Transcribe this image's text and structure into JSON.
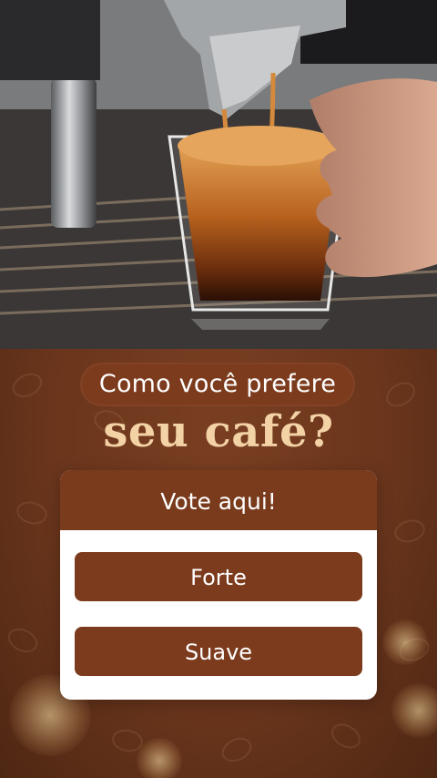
{
  "poll": {
    "question": "Como você prefere",
    "headline": "seu café?",
    "card_title": "Vote aqui!",
    "options": [
      "Forte",
      "Suave"
    ]
  },
  "colors": {
    "background_brown": "#6a351c",
    "button_brown": "#7c3b1c",
    "headline_cream": "#f3d2a6",
    "card_white": "#ffffff"
  },
  "icons": [
    "coffee-bean-pattern"
  ]
}
